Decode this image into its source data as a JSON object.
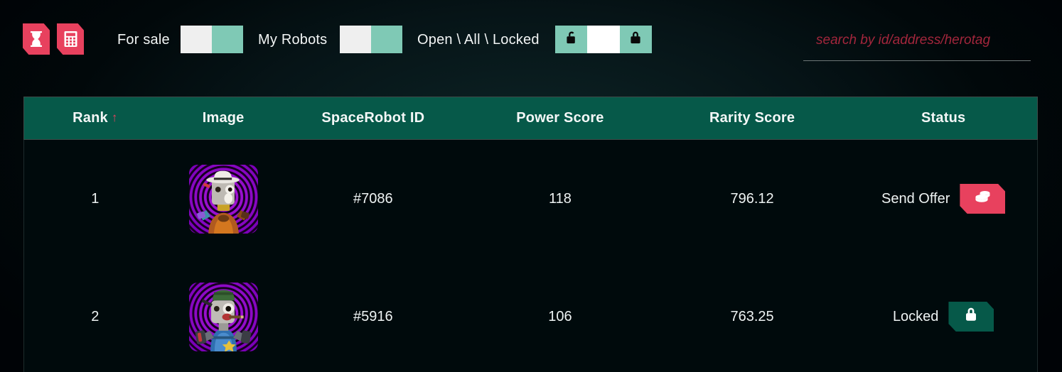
{
  "colors": {
    "accent_red": "#e8415e",
    "header_green": "#065949",
    "toggle_teal": "#7fc9b5",
    "toggle_off": "#efefef",
    "page_bg": "#000306",
    "row_bg": "#000a0c",
    "text": "#eef3f3"
  },
  "toolbar": {
    "icons": [
      {
        "name": "hourglass-icon",
        "label": "Hourglass"
      },
      {
        "name": "calculator-icon",
        "label": "Calculator"
      }
    ],
    "filters": [
      {
        "label": "For sale",
        "type": "toggle2",
        "state": "off"
      },
      {
        "label": "My Robots",
        "type": "toggle2",
        "state": "off"
      },
      {
        "label": "Open \\ All \\ Locked",
        "type": "toggle3",
        "state": "all"
      }
    ]
  },
  "search": {
    "placeholder": "search by id/address/herotag",
    "value": ""
  },
  "table": {
    "columns": [
      {
        "key": "rank",
        "label": "Rank",
        "sort": "asc",
        "sort_glyph": "↑"
      },
      {
        "key": "image",
        "label": "Image"
      },
      {
        "key": "id",
        "label": "SpaceRobot ID"
      },
      {
        "key": "power",
        "label": "Power Score"
      },
      {
        "key": "rarity",
        "label": "Rarity Score"
      },
      {
        "key": "status",
        "label": "Status"
      }
    ],
    "rows": [
      {
        "rank": "1",
        "image_alt": "space-robot-7086-thumbnail",
        "id": "#7086",
        "power": "118",
        "rarity": "796.12",
        "status_label": "Send Offer",
        "status_kind": "offer",
        "status_icon": "coins-icon"
      },
      {
        "rank": "2",
        "image_alt": "space-robot-5916-thumbnail",
        "id": "#5916",
        "power": "106",
        "rarity": "763.25",
        "status_label": "Locked",
        "status_kind": "locked",
        "status_icon": "padlock-closed-icon"
      }
    ]
  }
}
